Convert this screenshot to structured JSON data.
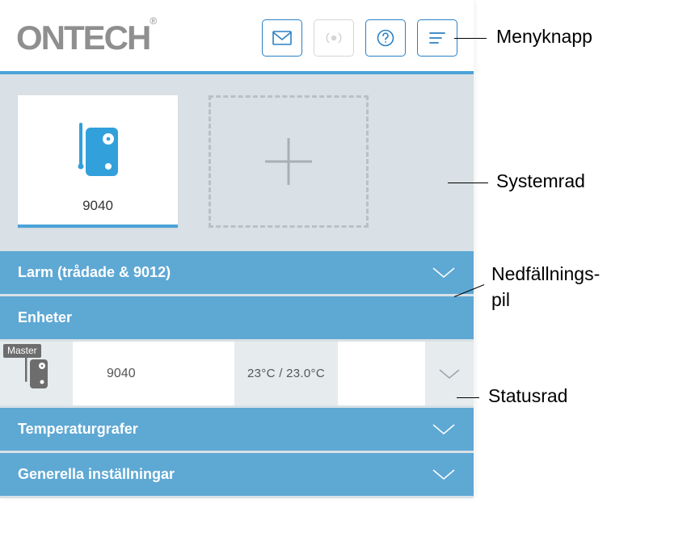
{
  "brand": "ONTECH",
  "trademark": "®",
  "header_icons": {
    "messages": "messages-icon",
    "broadcast": "broadcast-icon",
    "help": "help-icon",
    "menu": "menu-icon"
  },
  "system_row": {
    "device": {
      "label": "9040",
      "icon": "device-9040-icon"
    },
    "add": {
      "icon": "add-device-icon"
    }
  },
  "sections": {
    "larm": {
      "label": "Larm (trådade & 9012)"
    },
    "enheter": {
      "label": "Enheter"
    },
    "temperaturgrafer": {
      "label": "Temperaturgrafer"
    },
    "generella": {
      "label": "Generella inställningar"
    }
  },
  "status_row": {
    "badge": "Master",
    "name": "9040",
    "temperature": "23°C / 23.0°C"
  },
  "annotations": {
    "menu_button": "Menyknapp",
    "system_row": "Systemrad",
    "dropdown_arrow_1": "Nedfällnings-",
    "dropdown_arrow_2": "pil",
    "status_row": "Statusrad"
  },
  "colors": {
    "brand_gray": "#8f8f8f",
    "accent_blue": "#4aa3d8",
    "header_blue": "#5ea8d4",
    "icon_blue": "#2a80c4",
    "panel_bg": "#d9e1e6",
    "cell_bg": "#e6ebee"
  }
}
